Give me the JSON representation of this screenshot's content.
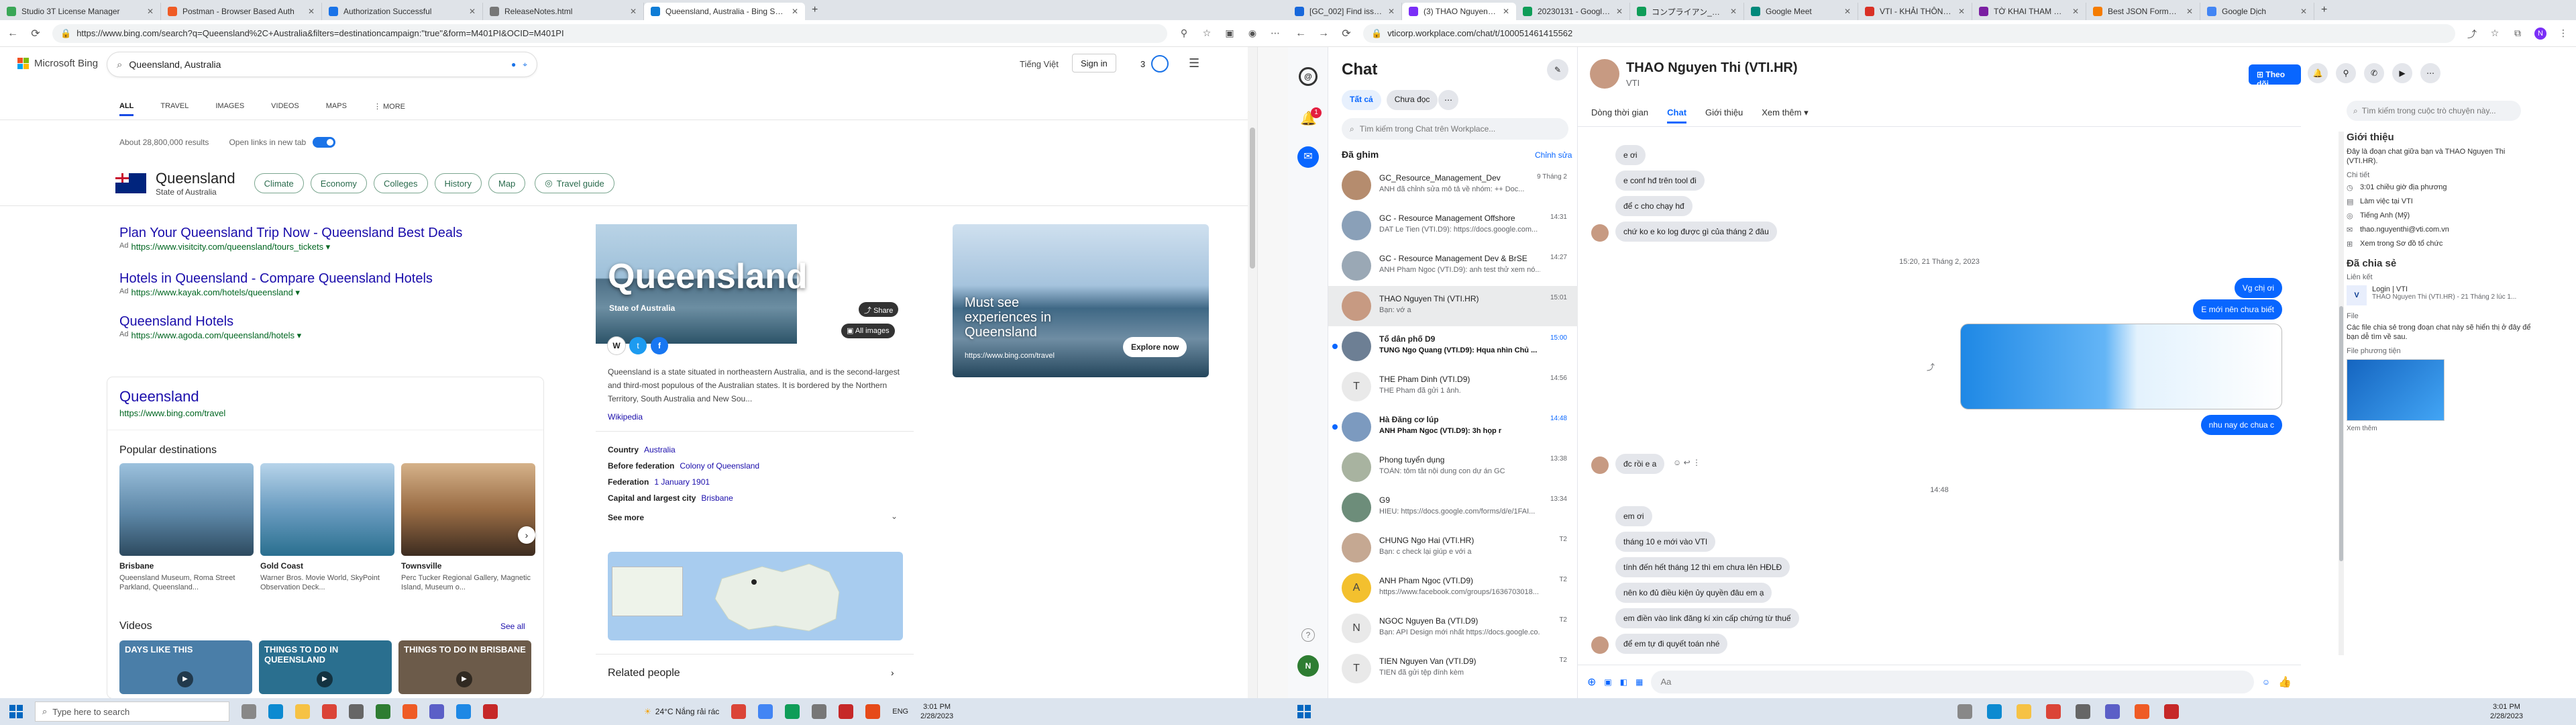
{
  "left_browser": {
    "tabs": [
      {
        "label": "Studio 3T License Manager",
        "color": "#3aa757"
      },
      {
        "label": "Postman - Browser Based Auth",
        "color": "#ef5b25"
      },
      {
        "label": "Authorization Successful",
        "color": "#1a73e8"
      },
      {
        "label": "ReleaseNotes.html",
        "color": "#777777"
      },
      {
        "label": "Queensland, Australia - Bing Se...",
        "color": "#0f7dd6"
      }
    ],
    "url": "https://www.bing.com/search?q=Queensland%2C+Australia&filters=destinationcampaign:\"true\"&form=M401PI&OCID=M401PI"
  },
  "bing": {
    "logo": "Microsoft Bing",
    "query": "Queensland, Australia",
    "lang": "Tiếng Việt",
    "signin": "Sign in",
    "points": "3",
    "scopes": [
      "ALL",
      "TRAVEL",
      "IMAGES",
      "VIDEOS",
      "MAPS",
      "⋮ MORE"
    ],
    "results_count": "About 28,800,000 results",
    "open_links": "Open links in new tab",
    "entity_title": "Queensland",
    "entity_sub": "State of Australia",
    "chips": [
      "Climate",
      "Economy",
      "Colleges",
      "History",
      "Map"
    ],
    "travel_guide": "Travel guide",
    "results": [
      {
        "title": "Plan Your Queensland Trip Now - Queensland Best Deals",
        "url": "https://www.visitcity.com/queensland/tours_tickets ▾"
      },
      {
        "title": "Hotels in Queensland - Compare Queensland Hotels",
        "url": "https://www.kayak.com/hotels/queensland ▾"
      },
      {
        "title": "Queensland Hotels",
        "url": "https://www.agoda.com/queensland/hotels ▾"
      }
    ],
    "ad": "Ad",
    "travel_card": {
      "title": "Queensland",
      "url": "https://www.bing.com/travel",
      "popular": "Popular destinations",
      "destinations": [
        {
          "name": "Brisbane",
          "desc": "Queensland Museum, Roma Street Parkland, Queensland..."
        },
        {
          "name": "Gold Coast",
          "desc": "Warner Bros. Movie World, SkyPoint Observation Deck..."
        },
        {
          "name": "Townsville",
          "desc": "Perc Tucker Regional Gallery, Magnetic Island, Museum o..."
        }
      ],
      "videos": "Videos",
      "see_all": "See all",
      "video_titles": [
        "DAYS LIKE THIS",
        "THINGS TO DO IN QUEENSLAND",
        "THINGS TO DO IN BRISBANE"
      ]
    },
    "kp": {
      "hero": "Queensland",
      "hero_sub": "State of Australia",
      "share": "Share",
      "all_images": "All images",
      "desc": "Queensland is a state situated in northeastern Australia, and is the second-largest and third-most populous of the Australian states. It is bordered by the Northern Territory, South Australia and New Sou...",
      "wiki": "Wikipedia",
      "facts": [
        {
          "k": "Country",
          "v": "Australia"
        },
        {
          "k": "Before federation",
          "v": "Colony of Queensland"
        },
        {
          "k": "Federation",
          "v": "1 January 1901"
        },
        {
          "k": "Capital and largest city",
          "v": "Brisbane"
        }
      ],
      "see_more": "See more",
      "related": "Related people"
    },
    "promo": {
      "headline": "Must see experiences in Queensland",
      "url": "https://www.bing.com/travel",
      "cta": "Explore now"
    }
  },
  "right_browser": {
    "tabs": [
      {
        "label": "[GC_002] Find issues",
        "color": "#1868db"
      },
      {
        "label": "(3) THAO Nguyen Th...",
        "color": "#7b2ff7"
      },
      {
        "label": "20230131 - Google S...",
        "color": "#0f9d58"
      },
      {
        "label": "コンプライアン_日中の2023...",
        "color": "#0f9d58"
      },
      {
        "label": "Google Meet",
        "color": "#00897b"
      },
      {
        "label": "VTI - KHẢI THÔNG T...",
        "color": "#d93025"
      },
      {
        "label": "TỜ KHAI THAM GIA ...",
        "color": "#7b1fa2"
      },
      {
        "label": "Best JSON Formatter ...",
        "color": "#f57c00"
      },
      {
        "label": "Google Dịch",
        "color": "#4285f4"
      }
    ],
    "url": "vticorp.workplace.com/chat/t/100051461415562"
  },
  "workplace": {
    "chat_title": "Chat",
    "filters": [
      "Tất cả",
      "Chưa đọc"
    ],
    "search_placeholder": "Tìm kiếm trong Chat trên Workplace...",
    "pinned": "Đã ghim",
    "edit": "Chỉnh sửa",
    "notification_count": "1",
    "avatar_letter": "N",
    "conversations": [
      {
        "name": "GC_Resource_Management_Dev",
        "preview": "ANH đã chỉnh sửa mô tả về nhóm: ++ Doc...",
        "time": "9 Tháng 2",
        "color": "#b58c6e",
        "letter": "",
        "bold": false,
        "unread": false
      },
      {
        "name": "GC - Resource Management Offshore",
        "preview": "DAT Le Tien (VTI.D9): https://docs.google.com...",
        "time": "14:31",
        "color": "#8aa0b8",
        "letter": "",
        "bold": false,
        "unread": false
      },
      {
        "name": "GC - Resource Management Dev & BrSE",
        "preview": "ANH Pham Ngoc (VTI.D9): anh test thử xem nó...",
        "time": "14:27",
        "color": "#9aa8b5",
        "letter": "",
        "bold": false,
        "unread": false
      },
      {
        "name": "THAO Nguyen Thi (VTI.HR)",
        "preview": "Bạn: vớ a",
        "time": "15:01",
        "color": "#c79a82",
        "letter": "",
        "bold": false,
        "unread": false,
        "active": true
      },
      {
        "name": "Tổ dân phố D9",
        "preview": "TUNG Ngo Quang (VTI.D9): Hqua nhìn Chủ ...",
        "time": "15:00",
        "color": "#6d7f94",
        "letter": "",
        "bold": true,
        "unread": true
      },
      {
        "name": "THE Pham Dinh (VTI.D9)",
        "preview": "THE Pham đã gửi 1 ảnh.",
        "time": "14:56",
        "color": "#e9e9e9",
        "letter": "T",
        "bold": false,
        "unread": false
      },
      {
        "name": "Hà Đăng cơ lúp",
        "preview": "ANH Pham Ngoc (VTI.D9): 3h họp r",
        "time": "14:48",
        "color": "#7c9abf",
        "letter": "",
        "bold": true,
        "unread": true
      },
      {
        "name": "Phong tuyển dụng",
        "preview": "TOÀN: tôm tắt nội dung con dự án GC",
        "time": "13:38",
        "color": "#a8b3a0",
        "letter": "",
        "bold": false,
        "unread": false
      },
      {
        "name": "G9",
        "preview": "HIEU: https://docs.google.com/forms/d/e/1FAI...",
        "time": "13:34",
        "color": "#6d8d7a",
        "letter": "",
        "bold": false,
        "unread": false
      },
      {
        "name": "CHUNG Ngo Hai (VTI.HR)",
        "preview": "Bạn: c check lại giúp e với a",
        "time": "T2",
        "color": "#c5a892",
        "letter": "",
        "bold": false,
        "unread": false
      },
      {
        "name": "ANH Pham Ngoc (VTI.D9)",
        "preview": "https://www.facebook.com/groups/1636703018...",
        "time": "T2",
        "color": "#f3c02e",
        "letter": "A",
        "bold": false,
        "unread": false
      },
      {
        "name": "NGOC Nguyen Ba (VTI.D9)",
        "preview": "Bạn: API Design mới nhất https://docs.google.co...",
        "time": "T2",
        "color": "#e9e9e9",
        "letter": "N",
        "bold": false,
        "unread": false
      },
      {
        "name": "TIEN Nguyen Van (VTI.D9)",
        "preview": "TIEN đã gửi tệp đính kèm",
        "time": "T2",
        "color": "#e9e9e9",
        "letter": "T",
        "bold": false,
        "unread": false
      }
    ],
    "header": {
      "name": "THAO Nguyen Thi (VTI.HR)",
      "org": "VTI",
      "follow": "Theo dõi",
      "tabs": [
        "Dòng thời gian",
        "Chat",
        "Giới thiệu",
        "Xem thêm ▾"
      ],
      "search_placeholder": "Tìm kiếm trong cuộc trò chuyện này..."
    },
    "messages_top": [
      {
        "text": "e ơi",
        "side": "in"
      },
      {
        "text": "e conf hđ trên tool đi",
        "side": "in"
      },
      {
        "text": "để c cho chạy hđ",
        "side": "in"
      },
      {
        "text": "chứ ko e ko log được gì của tháng 2 đâu",
        "side": "in"
      }
    ],
    "divider1": "15:20, 21 Tháng 2, 2023",
    "messages_mid_out": [
      "Vg chị ơi",
      "E mới nên chưa biết"
    ],
    "out_caption": "nhu nay dc chua c",
    "messages_after": [
      {
        "text": "đc rồi e a",
        "side": "in"
      }
    ],
    "divider2": "14:48",
    "messages_bottom": [
      "em ơi",
      "tháng 10 e mới vào VTI",
      "tính đến hết tháng 12 thì em chưa lên HĐLĐ",
      "nên ko đủ điều kiện ủy quyền đâu em ạ",
      "em điền vào link đăng kí xin cấp chứng từ thuế",
      "để em tự đi quyết toán nhé"
    ],
    "composer_placeholder": "Aa",
    "info": {
      "intro_title": "Giới thiệu",
      "intro_text": "Đây là đoạn chat giữa bạn và THAO Nguyen Thi (VTI.HR).",
      "detail_label": "Chi tiết",
      "details": [
        "3:01 chiều giờ địa phương",
        "Làm việc tại VTI",
        "Tiếng Anh (Mỹ)",
        "thao.nguyenthi@vti.com.vn",
        "Xem trong Sơ đồ tổ chức"
      ],
      "shared_title": "Đã chia sẻ",
      "links_label": "Liên kết",
      "link_title": "Login | VTI",
      "link_sub": "THAO Nguyen Thi (VTI.HR) - 21 Tháng 2 lúc 1...",
      "file_label": "File",
      "file_text": "Các file chia sẻ trong đoạn chat này sẽ hiển thị ở đây để bạn dễ tìm về sau.",
      "media_label": "File phương tiện",
      "see_all": "Xem thêm"
    }
  },
  "taskbar_left": {
    "search": "Type here to search",
    "weather": "24°C  Nắng rải rác",
    "lang": "ENG",
    "time": "3:01 PM",
    "date": "2/28/2023"
  },
  "taskbar_right": {
    "time": "3:01 PM",
    "date": "2/28/2023"
  }
}
